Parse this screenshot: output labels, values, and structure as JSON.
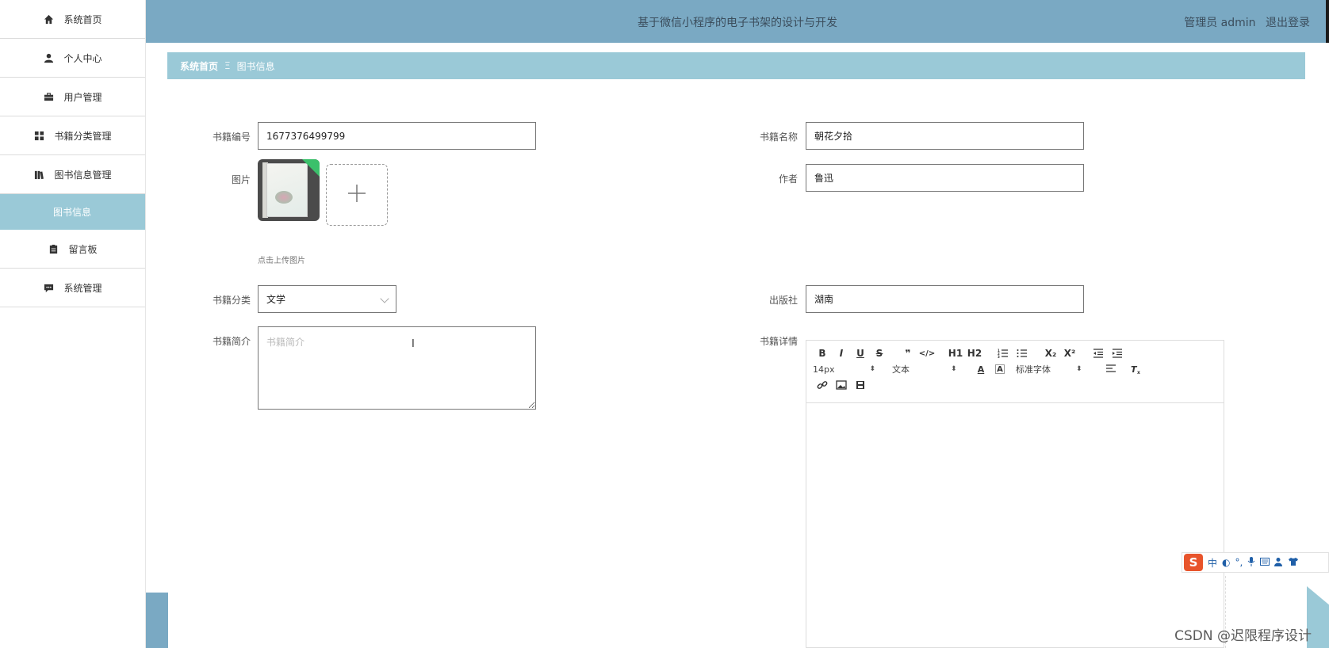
{
  "sidebar": {
    "items": [
      {
        "label": "系统首页",
        "icon": "home-icon"
      },
      {
        "label": "个人中心",
        "icon": "user-icon"
      },
      {
        "label": "用户管理",
        "icon": "briefcase-icon"
      },
      {
        "label": "书籍分类管理",
        "icon": "grid-icon"
      },
      {
        "label": "图书信息管理",
        "icon": "books-icon"
      }
    ],
    "active_sub": "图书信息",
    "items_after": [
      {
        "label": "留言板",
        "icon": "clipboard-icon"
      },
      {
        "label": "系统管理",
        "icon": "chat-icon"
      }
    ]
  },
  "header": {
    "title": "基于微信小程序的电子书架的设计与开发",
    "role": "管理员 admin",
    "logout": "退出登录"
  },
  "breadcrumb": {
    "home": "系统首页",
    "separator": "Ξ",
    "current": "图书信息"
  },
  "form": {
    "book_no_label": "书籍编号",
    "book_no_value": "1677376499799",
    "book_name_label": "书籍名称",
    "book_name_value": "朝花夕拾",
    "image_label": "图片",
    "upload_hint": "点击上传图片",
    "author_label": "作者",
    "author_value": "鲁迅",
    "category_label": "书籍分类",
    "category_value": "文学",
    "publisher_label": "出版社",
    "publisher_value": "湖南",
    "intro_label": "书籍简介",
    "intro_placeholder": "书籍简介",
    "detail_label": "书籍详情"
  },
  "editor": {
    "row1": [
      "B",
      "I",
      "U",
      "S",
      "❞",
      "</>",
      "H1",
      "H2",
      "ordered-list-icon",
      "bullet-list-icon",
      "X₂",
      "X²",
      "outdent-icon",
      "indent-icon"
    ],
    "font_size": "14px",
    "text_type": "文本",
    "font_family": "标准字体"
  },
  "ime": {
    "logo": "S",
    "mode": "中"
  },
  "watermark": "CSDN @迟限程序设计",
  "colors": {
    "header_bg": "#7aa9c3",
    "breadcrumb_bg": "#9ac9d7",
    "active_sidebar_bg": "#9ac9d7"
  }
}
